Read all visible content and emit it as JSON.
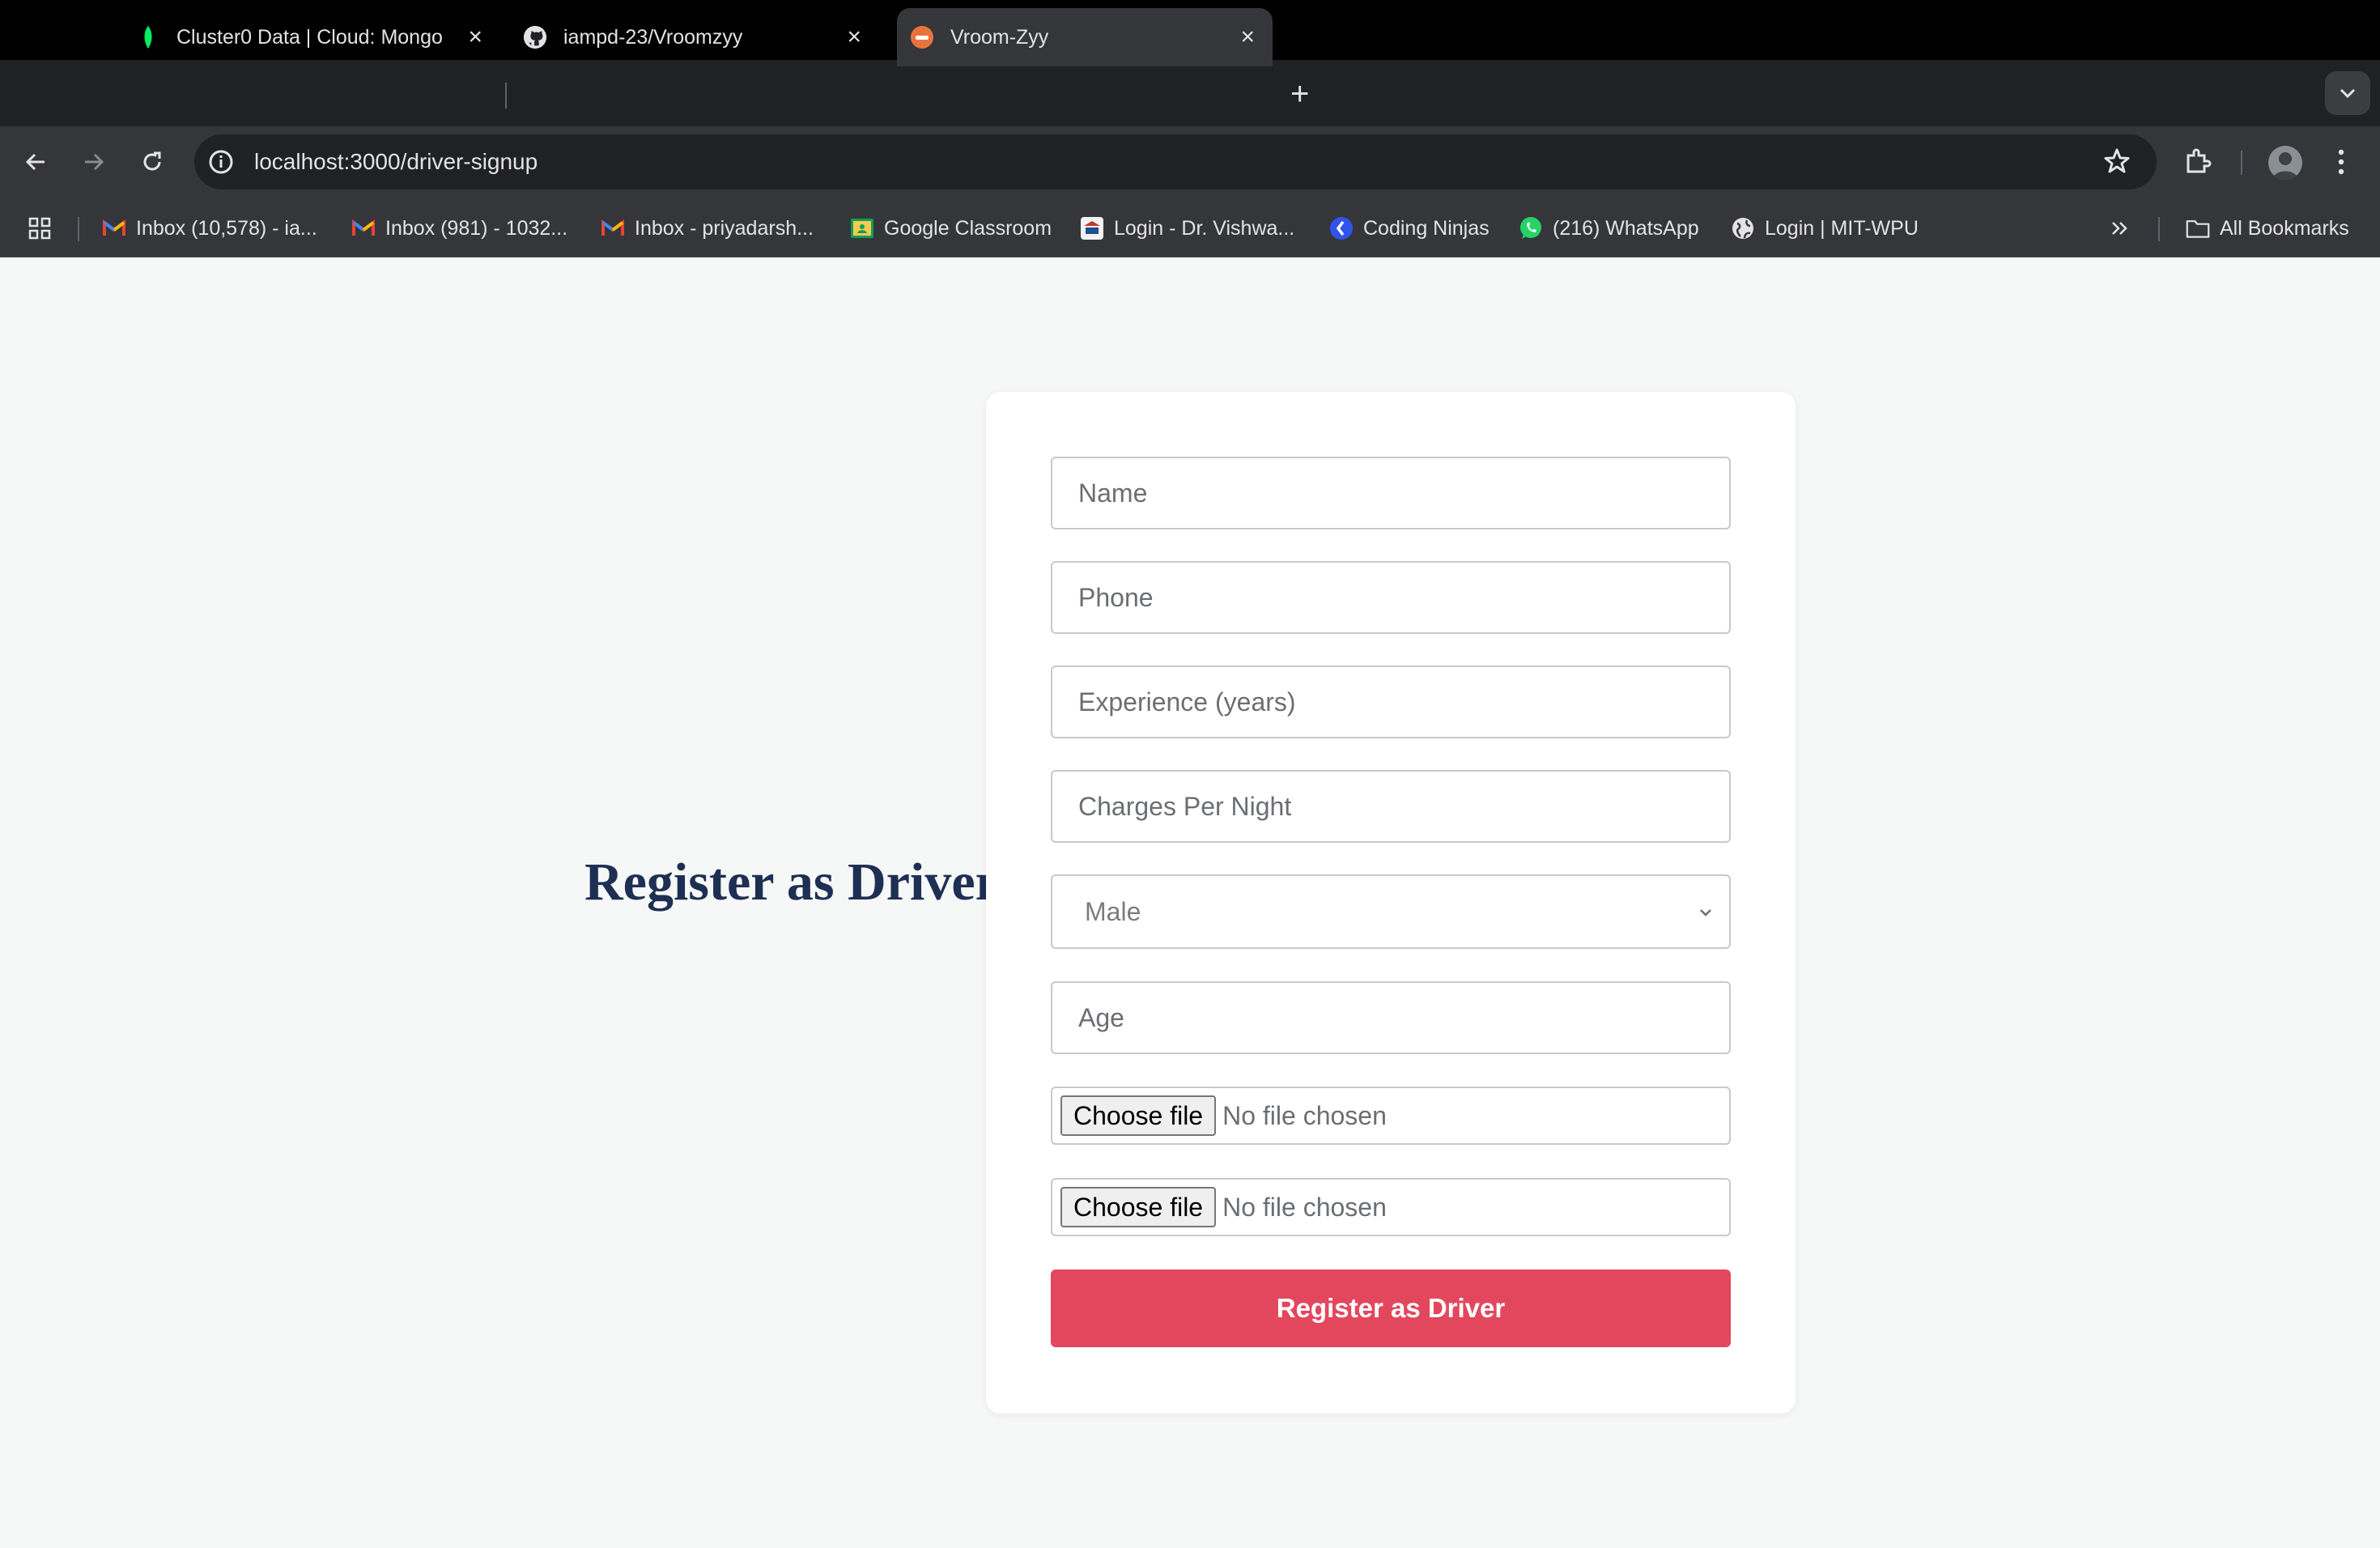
{
  "browser": {
    "tabs": [
      {
        "title": "Cluster0 Data | Cloud: Mongo",
        "icon": "mongodb-leaf-icon",
        "active": false
      },
      {
        "title": "iampd-23/Vroomzyy",
        "icon": "github-icon",
        "active": false
      },
      {
        "title": "Vroom-Zyy",
        "icon": "vroomzyy-favicon",
        "active": true
      }
    ],
    "url": "localhost:3000/driver-signup",
    "bookmarks": [
      {
        "label": "Inbox (10,578) - ia...",
        "icon": "gmail-icon"
      },
      {
        "label": "Inbox (981) - 1032...",
        "icon": "gmail-icon"
      },
      {
        "label": "Inbox - priyadarsh...",
        "icon": "gmail-icon"
      },
      {
        "label": "Google Classroom",
        "icon": "classroom-icon"
      },
      {
        "label": "Login - Dr. Vishwa...",
        "icon": "university-icon"
      },
      {
        "label": "Coding Ninjas",
        "icon": "coding-ninjas-icon"
      },
      {
        "label": "(216) WhatsApp",
        "icon": "whatsapp-icon"
      },
      {
        "label": "Login | MIT-WPU",
        "icon": "globe-icon"
      }
    ],
    "all_bookmarks_label": "All Bookmarks"
  },
  "page": {
    "heading": "Register as Driver",
    "form": {
      "name_placeholder": "Name",
      "phone_placeholder": "Phone",
      "experience_placeholder": "Experience (years)",
      "charges_placeholder": "Charges Per Night",
      "gender_selected": "Male",
      "age_placeholder": "Age",
      "file_button_label": "Choose file",
      "file_status": "No file chosen",
      "submit_label": "Register as Driver"
    }
  },
  "colors": {
    "accent": "#e3475e",
    "heading": "#1e2f54",
    "page_bg": "#f6f7f7"
  }
}
